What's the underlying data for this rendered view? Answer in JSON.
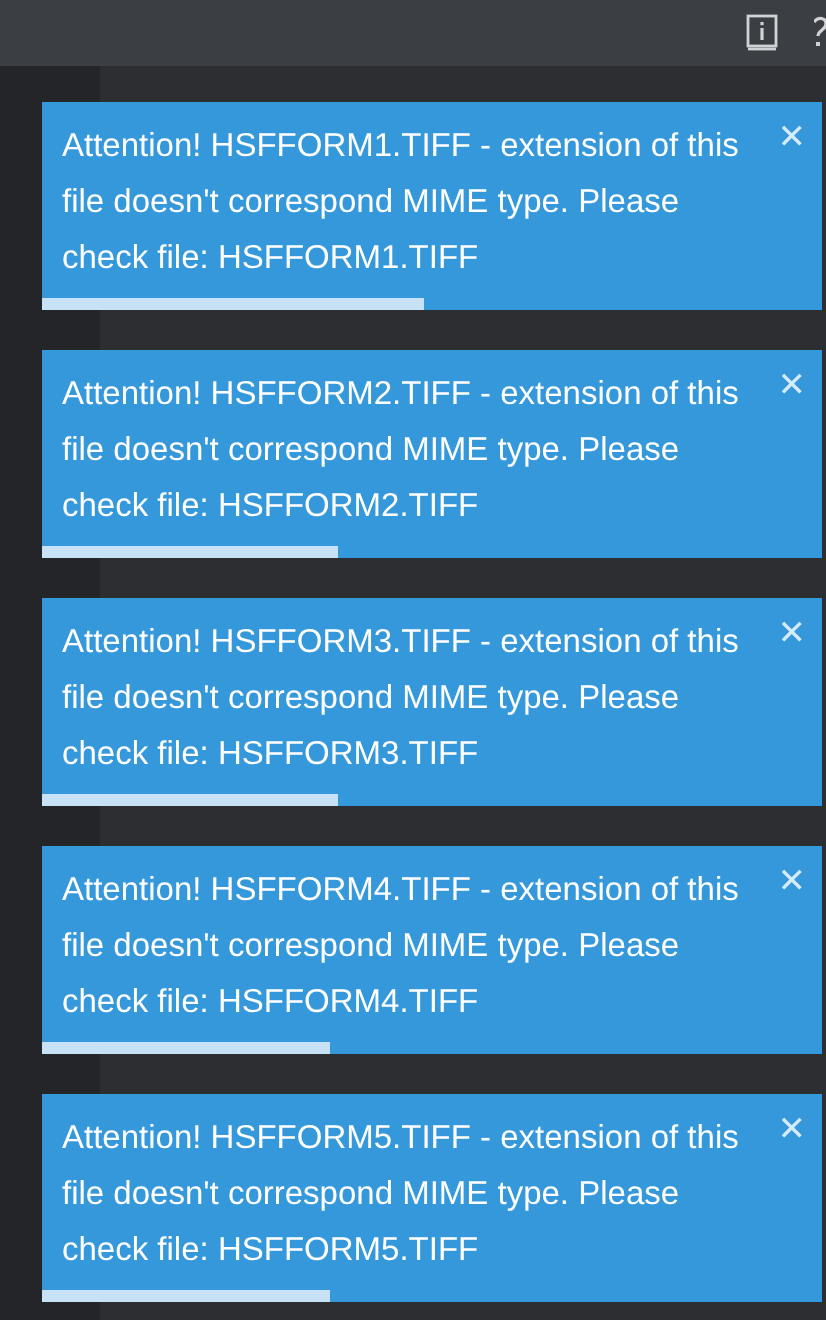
{
  "toasts": [
    {
      "message": "Attention! HSFFORM1.TIFF - extension of this file doesn't correspond MIME type. Please check file: HSFFORM1.TIFF",
      "close": "✕",
      "level": 0.49
    },
    {
      "message": "Attention! HSFFORM2.TIFF - extension of this file doesn't correspond MIME type. Please check file: HSFFORM2.TIFF",
      "close": "✕",
      "level": 0.38
    },
    {
      "message": "Attention! HSFFORM3.TIFF - extension of this file doesn't correspond MIME type. Please check file: HSFFORM3.TIFF",
      "close": "✕",
      "level": 0.38
    },
    {
      "message": "Attention! HSFFORM4.TIFF - extension of this file doesn't correspond MIME type. Please check file: HSFFORM4.TIFF",
      "close": "✕",
      "level": 0.37
    },
    {
      "message": "Attention! HSFFORM5.TIFF - extension of this file doesn't correspond MIME type. Please check file: HSFFORM5.TIFF",
      "close": "✕",
      "level": 0.37
    }
  ]
}
